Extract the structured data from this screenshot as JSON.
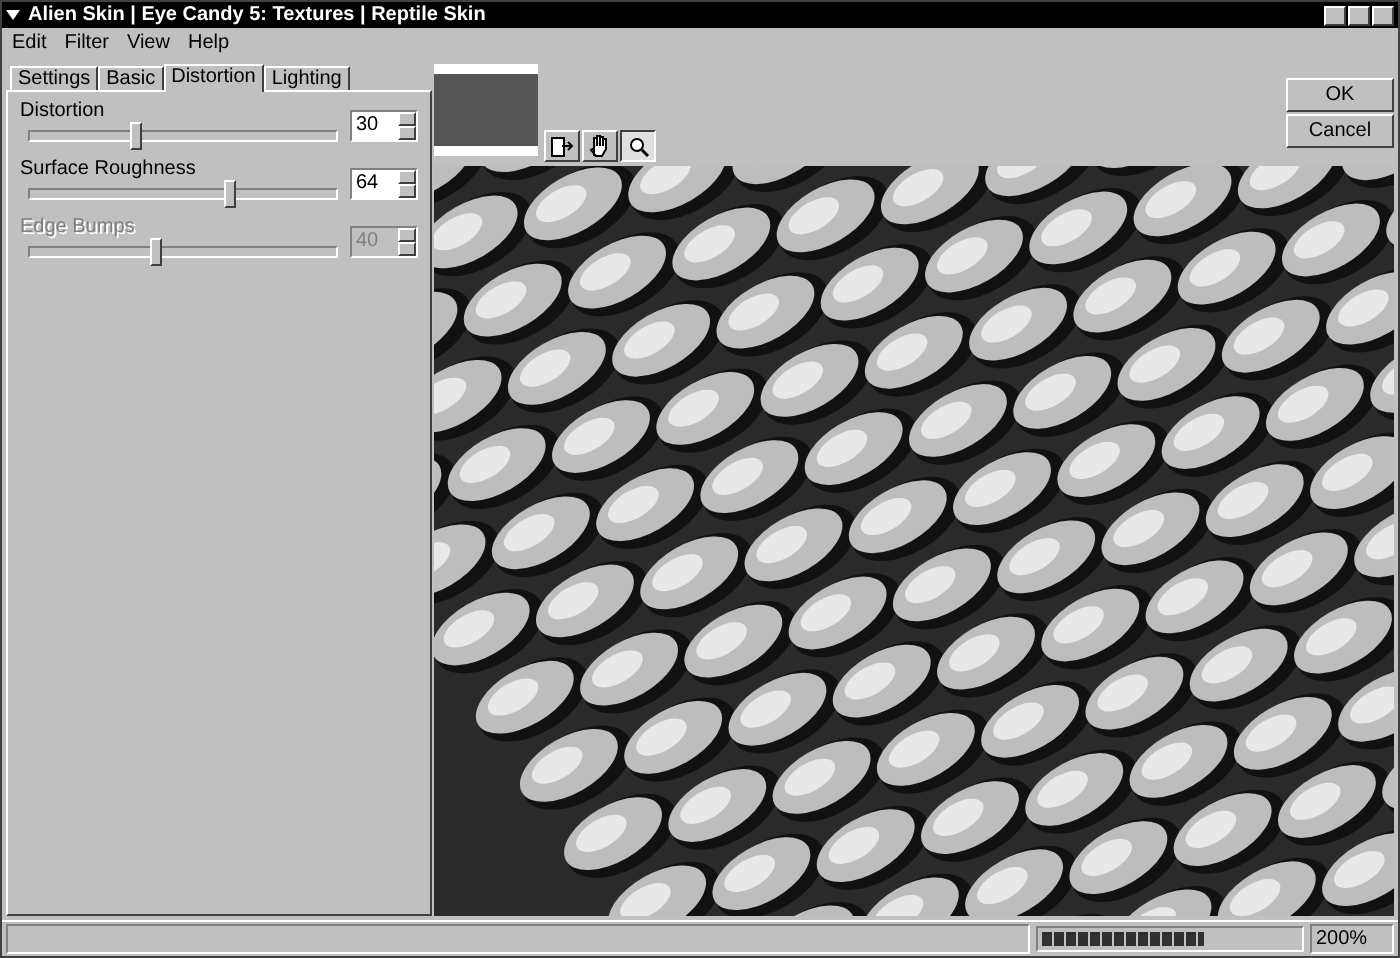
{
  "window": {
    "title": "Alien Skin | Eye Candy 5: Textures | Reptile Skin"
  },
  "menu": [
    "Edit",
    "Filter",
    "View",
    "Help"
  ],
  "tabs": [
    {
      "label": "Settings",
      "selected": false
    },
    {
      "label": "Basic",
      "selected": false
    },
    {
      "label": "Distortion",
      "selected": true
    },
    {
      "label": "Lighting",
      "selected": false
    }
  ],
  "sliders": [
    {
      "label": "Distortion",
      "value": "30",
      "level": 0.35,
      "disabled": false
    },
    {
      "label": "Surface Roughness",
      "value": "64",
      "level": 0.65,
      "disabled": false
    },
    {
      "label": "Edge Bumps",
      "value": "40",
      "level": 0.41,
      "disabled": true
    }
  ],
  "buttons": [
    "OK",
    "Cancel"
  ],
  "tools": [
    {
      "kind": "navigate",
      "selected": false
    },
    {
      "kind": "hand",
      "selected": false
    },
    {
      "kind": "zoom",
      "selected": true
    }
  ],
  "status_bar": {
    "progress": {
      "level": 0.63
    },
    "zoom": "200%"
  }
}
